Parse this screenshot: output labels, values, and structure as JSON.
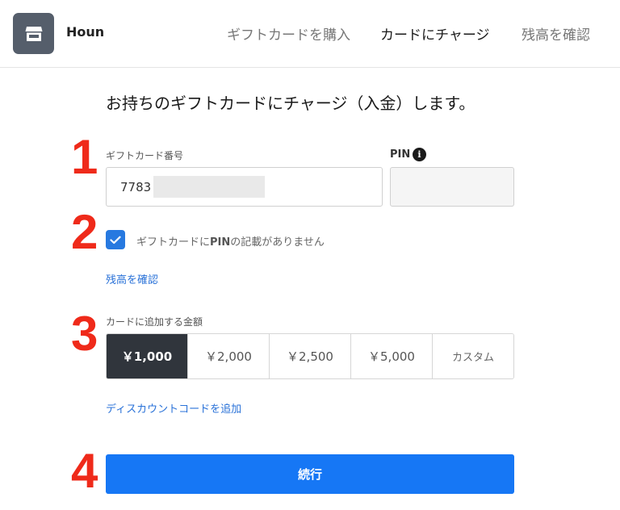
{
  "header": {
    "store_name": "Houn",
    "nav": {
      "buy": "ギフトカードを購入",
      "charge": "カードにチャージ",
      "balance": "残高を確認"
    }
  },
  "steps": [
    "1",
    "2",
    "3",
    "4"
  ],
  "form": {
    "heading": "お持ちのギフトカードにチャージ（入金）します。",
    "card_number_label": "ギフトカード番号",
    "card_number_value": "7783",
    "pin_label": "PIN",
    "pin_info_glyph": "i",
    "no_pin_label_pre": "ギフトカードに",
    "no_pin_label_bold": "PIN",
    "no_pin_label_post": "の記載がありません",
    "no_pin_checked": true,
    "check_balance_link": "残高を確認",
    "amount_label": "カードに追加する金額",
    "amounts": [
      "￥1,000",
      "￥2,000",
      "￥2,500",
      "￥5,000",
      "カスタム"
    ],
    "selected_amount_index": 0,
    "discount_link": "ディスカウントコードを追加",
    "continue_label": "続行"
  },
  "colors": {
    "step_number": "#ef2a1a",
    "primary": "#1677f5",
    "link": "#2a72d8",
    "selected_amount": "#30353c",
    "logo_bg": "#555e6b"
  }
}
